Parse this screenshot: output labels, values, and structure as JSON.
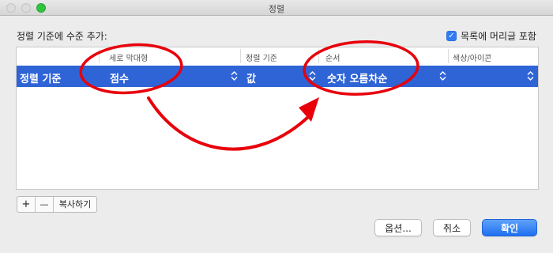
{
  "window": {
    "title": "정렬"
  },
  "header": {
    "label": "정렬 기준에 수준 추가:"
  },
  "checkbox": {
    "checked": true,
    "label": "목록에 머리글 포함"
  },
  "table": {
    "columns": [
      "세로 막대형",
      "정렬 기준",
      "순서",
      "색상/아이콘"
    ],
    "row": {
      "label": "정렬 기준",
      "column": "점수",
      "sort_on": "값",
      "order": "숫자 오름차순",
      "color": ""
    }
  },
  "toolbar": {
    "add": "+",
    "remove": "—",
    "copy": "복사하기"
  },
  "buttons": {
    "options": "옵션...",
    "cancel": "취소",
    "ok": "확인"
  },
  "colors": {
    "selection": "#2f64d6",
    "accent": "#2f7cf6",
    "annotation": "#e8000b"
  }
}
